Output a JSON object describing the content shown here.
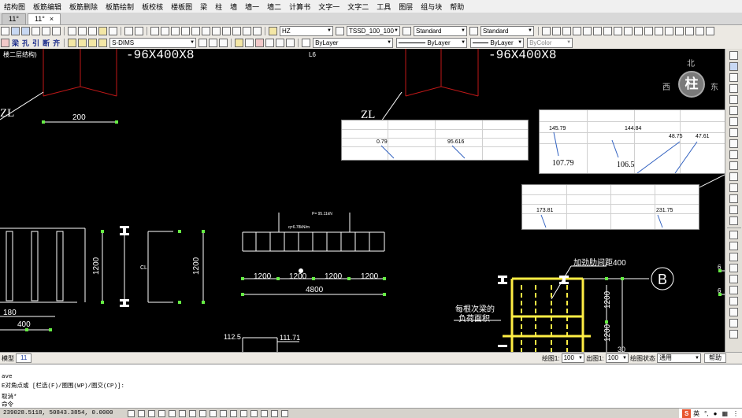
{
  "menu": [
    "结构图",
    "板筋编辑",
    "板筋删除",
    "板筋绘制",
    "板校核",
    "楼板图",
    "梁",
    "柱",
    "墙",
    "墙一",
    "墙二",
    "计算书",
    "文字一",
    "文字二",
    "工具",
    "图层",
    "组与块",
    "帮助"
  ],
  "tabs": [
    {
      "label": "11°",
      "active": false
    },
    {
      "label": "11°",
      "active": true
    }
  ],
  "toolbar": {
    "text_style": "HZ",
    "dim_style": "TSSD_100_100",
    "table_style1": "Standard",
    "table_style2": "Standard",
    "layer_current": "S-DIMS",
    "color": "ByLayer",
    "linetype": "ByLayer",
    "lineweight": "ByLayer",
    "plotstyle": "ByColor",
    "cn_tools": [
      "梁",
      "孔",
      "引",
      "断",
      "齐"
    ]
  },
  "drawing": {
    "title_fragment": "楼二层结构)",
    "beam_label_1": "-96X400X8",
    "beam_label_2": "-96X400X8",
    "label_L6": "L6",
    "zl_1": "ZL",
    "zl_2": "ZL",
    "dim_200": "200",
    "dim_1200_a": "1200",
    "dim_1200_b": "1200",
    "dim_180": "180",
    "dim_400": "400",
    "cl": "CL",
    "load_top": "P= 95.11kN",
    "load_mid": "q=6.78kN/m",
    "spans": [
      "1200",
      "1200",
      "1200",
      "1200"
    ],
    "dim_4800": "4800",
    "note_stiffener": "加劲肋间距400",
    "note_each_beam_1": "每根次梁的",
    "note_each_beam_2": "负荷面积",
    "axis_b": "B",
    "dim_1200_v1": "1200",
    "dim_1200_v2": "1200",
    "dim_30": "30",
    "val_112_5": "112.5",
    "val_111_71": "111.71",
    "right_6a": "6",
    "right_6b": "6"
  },
  "compass": {
    "north": "北",
    "west": "西",
    "east": "东",
    "center": "柱"
  },
  "tables": {
    "t1": {
      "values": [
        "0.79",
        "95.616"
      ]
    },
    "t2": {
      "top": [
        "145.79",
        "144.84",
        "48.75",
        "47.61"
      ],
      "bottom": [
        "107.79",
        "106.5"
      ]
    },
    "t3": {
      "values": [
        "173.81",
        "231.75"
      ]
    }
  },
  "status": {
    "layout_left": "模型",
    "layout_tab": "11",
    "drawing_scale_label": "绘图1:",
    "drawing_scale": "100",
    "output_scale_label": "出图1:",
    "output_scale": "100",
    "layer_state_label": "绘图状态",
    "layer_state": "通用",
    "help": "帮助"
  },
  "command": {
    "lines": [
      "ave",
      "E对角点或 [栏选(F)/圈围(WP)/圈交(CP)]:",
      "",
      "取消*",
      "命令"
    ]
  },
  "bottom": {
    "coords": "239028.5118, 50843.3854, 0.0000",
    "ime": "英",
    "ime_logo": "S"
  }
}
